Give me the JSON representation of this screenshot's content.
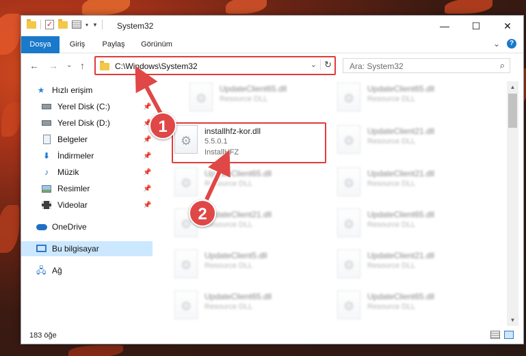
{
  "window": {
    "title": "System32",
    "controls": {
      "minimize": "—",
      "maximize": "☐",
      "close": "✕"
    }
  },
  "ribbon": {
    "tabs": [
      "Dosya",
      "Giriş",
      "Paylaş",
      "Görünüm"
    ],
    "expand_glyph": "⌄",
    "help_glyph": "?"
  },
  "navigation": {
    "back": "←",
    "forward": "→",
    "recent": "⌄",
    "up": "↑",
    "address_path": "C:\\Windows\\System32",
    "address_dropdown": "⌄",
    "refresh": "↻",
    "search_placeholder": "Ara: System32",
    "search_icon": "search-icon"
  },
  "sidebar": {
    "items": [
      {
        "label": "Hızlı erişim",
        "icon": "star-icon",
        "pinned": false
      },
      {
        "label": "Yerel Disk (C:)",
        "icon": "drive-icon",
        "pinned": true
      },
      {
        "label": "Yerel Disk (D:)",
        "icon": "drive-icon",
        "pinned": true
      },
      {
        "label": "Belgeler",
        "icon": "documents-icon",
        "pinned": true
      },
      {
        "label": "İndirmeler",
        "icon": "downloads-icon",
        "pinned": true
      },
      {
        "label": "Müzik",
        "icon": "music-icon",
        "pinned": true
      },
      {
        "label": "Resimler",
        "icon": "pictures-icon",
        "pinned": true
      },
      {
        "label": "Videolar",
        "icon": "videos-icon",
        "pinned": true
      },
      {
        "label": "OneDrive",
        "icon": "onedrive-icon",
        "pinned": false
      },
      {
        "label": "Bu bilgisayar",
        "icon": "this-pc-icon",
        "pinned": false,
        "selected": true
      },
      {
        "label": "Ağ",
        "icon": "network-icon",
        "pinned": false
      }
    ],
    "pin_glyph": "📌"
  },
  "files": {
    "left_column": [
      {
        "name": "UpdateClient65.dll",
        "type": "Resource DLL"
      },
      {
        "name": "installhfz-kor.dll",
        "version": "5.5.0.1",
        "company": "InstallHFZ"
      },
      {
        "name": "UpdateClient65.dll",
        "type": "Resource DLL"
      },
      {
        "name": "UpdateClient21.dll",
        "type": "Resource DLL"
      },
      {
        "name": "UpdateClient5.dll",
        "type": "Resource DLL"
      },
      {
        "name": "UpdateClient65.dll",
        "type": "Resource DLL"
      }
    ],
    "right_column": [
      {
        "name": "UpdateClient65.dll",
        "type": "Resource DLL"
      },
      {
        "name": "UpdateClient21.dll",
        "type": "Resource DLL"
      },
      {
        "name": "UpdateClient21.dll",
        "type": "Resource DLL"
      },
      {
        "name": "UpdateClient65.dll",
        "type": "Resource DLL"
      },
      {
        "name": "UpdateClient21.dll",
        "type": "Resource DLL"
      },
      {
        "name": "UpdateClient65.dll",
        "type": "Resource DLL"
      }
    ]
  },
  "status": {
    "item_count": "183 öğe"
  },
  "callouts": {
    "step1": "1",
    "step2": "2"
  },
  "colors": {
    "accent": "#1979ca",
    "callout": "#e04747",
    "selection": "#cce8ff"
  }
}
